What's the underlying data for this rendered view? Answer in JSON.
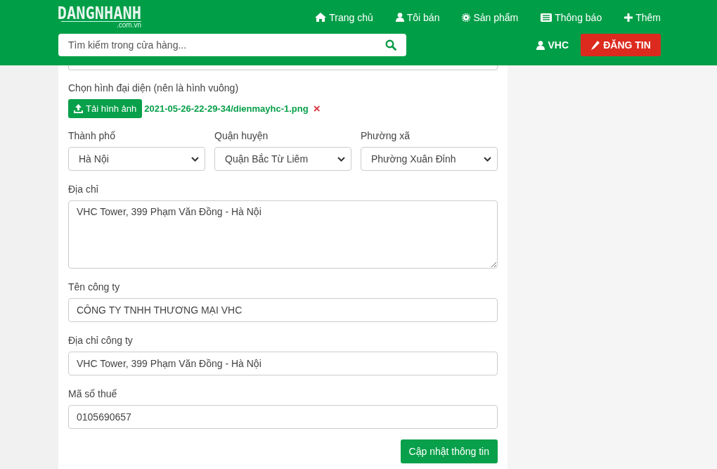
{
  "header": {
    "logo": {
      "name": "DANGNHANH",
      "domain": ".com.vn"
    },
    "nav": [
      {
        "kind": "home",
        "label": "Trang chủ"
      },
      {
        "kind": "user",
        "label": "Tôi bán"
      },
      {
        "kind": "gear",
        "label": "Sản phẩm"
      },
      {
        "kind": "list",
        "label": "Thông báo"
      },
      {
        "kind": "plus",
        "label": "Thêm"
      }
    ],
    "search": {
      "placeholder": "Tìm kiếm trong cửa hàng..."
    },
    "user": "VHC",
    "post_button": "ĐĂNG TIN"
  },
  "form": {
    "avatar": {
      "label": "Chọn hình đại diện (nên là hình vuông)",
      "button": "Tải hình ảnh",
      "file": "2021-05-26-22-29-34/dienmayhc-1.png",
      "remove": "×"
    },
    "location": [
      {
        "label": "Thành phố",
        "value": "Hà Nội"
      },
      {
        "label": "Quận huyện",
        "value": "Quận Bắc Từ Liêm"
      },
      {
        "label": "Phường xã",
        "value": "Phường Xuân Đỉnh"
      }
    ],
    "fields": [
      {
        "kind": "textarea",
        "label": "Địa chỉ",
        "value": "VHC Tower, 399 Phạm Văn Đồng - Hà Nội"
      },
      {
        "kind": "input",
        "label": "Tên công ty",
        "value": "CÔNG TY TNHH THƯƠNG MẠI VHC"
      },
      {
        "kind": "input",
        "label": "Địa chỉ công ty",
        "value": "VHC Tower, 399 Phạm Văn Đồng - Hà Nội"
      },
      {
        "kind": "input",
        "label": "Mã số thuế",
        "value": "0105690657"
      }
    ],
    "submit": "Cập nhật thông tin"
  }
}
